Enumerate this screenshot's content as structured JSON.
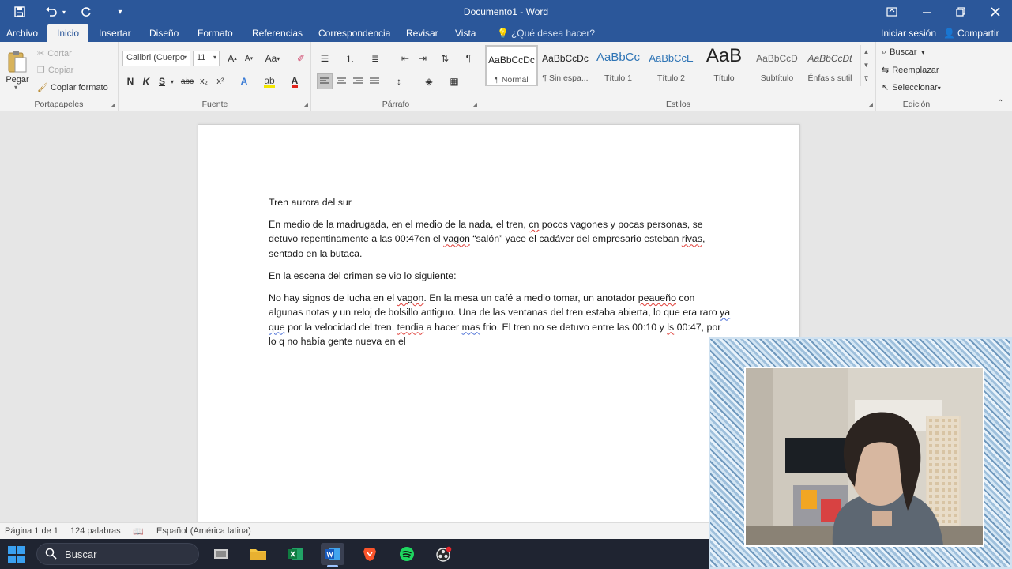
{
  "window": {
    "title": "Documento1 - Word"
  },
  "tabs": [
    {
      "label": "Archivo"
    },
    {
      "label": "Inicio"
    },
    {
      "label": "Insertar"
    },
    {
      "label": "Diseño"
    },
    {
      "label": "Formato"
    },
    {
      "label": "Referencias"
    },
    {
      "label": "Correspondencia"
    },
    {
      "label": "Revisar"
    },
    {
      "label": "Vista"
    }
  ],
  "tell_me": "¿Qué desea hacer?",
  "account": {
    "signin": "Iniciar sesión",
    "share": "Compartir"
  },
  "ribbon": {
    "clipboard": {
      "label": "Portapapeles",
      "paste": "Pegar",
      "cut": "Cortar",
      "copy": "Copiar",
      "format_painter": "Copiar formato"
    },
    "font": {
      "label": "Fuente",
      "font_name": "Calibri (Cuerpo",
      "font_size": "11",
      "bold": "N",
      "italic": "K",
      "underline": "S",
      "strike": "abc",
      "subscript": "x₂",
      "superscript": "x²",
      "grow": "A",
      "shrink": "A",
      "case": "Aa"
    },
    "paragraph": {
      "label": "Párrafo"
    },
    "styles": {
      "label": "Estilos",
      "items": [
        {
          "sample": "AaBbCcDc",
          "name": "¶ Normal"
        },
        {
          "sample": "AaBbCcDc",
          "name": "¶ Sin espa..."
        },
        {
          "sample": "AaBbCc",
          "name": "Título 1"
        },
        {
          "sample": "AaBbCcE",
          "name": "Título 2"
        },
        {
          "sample": "AaB",
          "name": "Título"
        },
        {
          "sample": "AaBbCcD",
          "name": "Subtítulo"
        },
        {
          "sample": "AaBbCcDt",
          "name": "Énfasis sutil"
        }
      ]
    },
    "editing": {
      "label": "Edición",
      "find": "Buscar",
      "replace": "Reemplazar",
      "select": "Seleccionar"
    }
  },
  "document": {
    "title_line": "Tren aurora del sur",
    "p1": {
      "a": "En medio de la madrugada, en el medio de la nada, el tren, ",
      "b": "cn",
      "c": " pocos vagones y pocas personas, se detuvo repentinamente a las 00:47en el ",
      "d": "vagon",
      "e": " “salón” yace el cadáver del empresario esteban ",
      "f": "rivas",
      "g": ", sentado en la butaca."
    },
    "p2": "En la escena del crimen se vio lo siguiente:",
    "p3": {
      "a": "No hay signos de lucha en el ",
      "b": "vagon",
      "c": ". En la mesa un café a medio tomar, un anotador ",
      "d": "peaueño",
      "e": " con algunas notas y un reloj de bolsillo antiguo. Una de las ventanas del tren estaba abierta, lo que era raro ",
      "f": "ya que",
      "g": " por la velocidad del tren, ",
      "h": "tendia",
      "i": " a hacer ",
      "j": "mas",
      "k": " frio. El tren no se detuvo entre las 00:10 y ",
      "l": "ls",
      "m": " 00:47, por lo q no había gente nueva en el"
    }
  },
  "status": {
    "page": "Página 1 de 1",
    "words": "124 palabras",
    "language": "Español (América latina)"
  },
  "taskbar": {
    "search_placeholder": "Buscar",
    "apps": [
      "file-explorer",
      "excel",
      "word",
      "brave",
      "spotify",
      "obs"
    ]
  }
}
